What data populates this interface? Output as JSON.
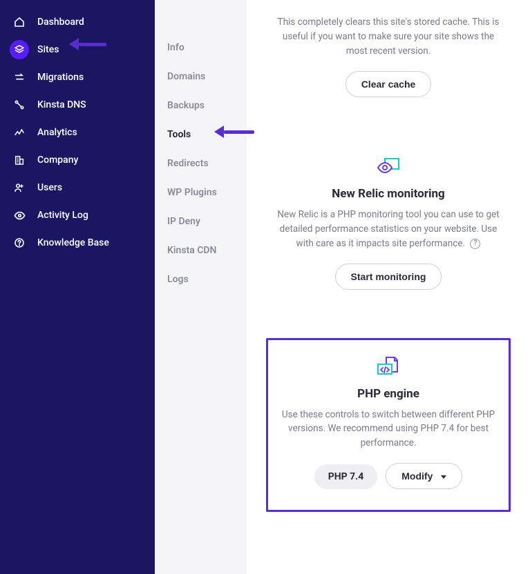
{
  "sidebar": {
    "items": [
      {
        "label": "Dashboard"
      },
      {
        "label": "Sites"
      },
      {
        "label": "Migrations"
      },
      {
        "label": "Kinsta DNS"
      },
      {
        "label": "Analytics"
      },
      {
        "label": "Company"
      },
      {
        "label": "Users"
      },
      {
        "label": "Activity Log"
      },
      {
        "label": "Knowledge Base"
      }
    ],
    "active_index": 1
  },
  "subnav": {
    "items": [
      {
        "label": "Info"
      },
      {
        "label": "Domains"
      },
      {
        "label": "Backups"
      },
      {
        "label": "Tools"
      },
      {
        "label": "Redirects"
      },
      {
        "label": "WP Plugins"
      },
      {
        "label": "IP Deny"
      },
      {
        "label": "Kinsta CDN"
      },
      {
        "label": "Logs"
      }
    ],
    "active_index": 3
  },
  "cards": {
    "cache": {
      "description": "This completely clears this site's stored cache. This is useful if you want to make sure your site shows the most recent version.",
      "button": "Clear cache"
    },
    "newrelic": {
      "title": "New Relic monitoring",
      "description": "New Relic is a PHP monitoring tool you can use to get detailed performance statistics on your website. Use with care as it impacts site performance.",
      "button": "Start monitoring"
    },
    "php": {
      "title": "PHP engine",
      "description": "Use these controls to switch between different PHP versions. We recommend using PHP 7.4 for best performance.",
      "version_label": "PHP 7.4",
      "modify_label": "Modify"
    }
  }
}
